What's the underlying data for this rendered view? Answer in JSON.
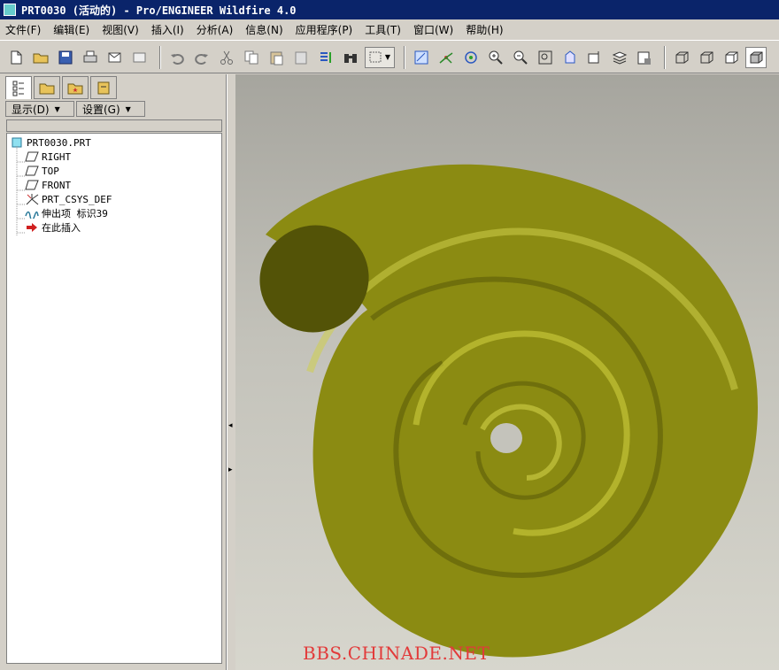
{
  "window": {
    "title": "PRT0030 (活动的) - Pro/ENGINEER Wildfire 4.0"
  },
  "menus": [
    "文件(F)",
    "编辑(E)",
    "视图(V)",
    "插入(I)",
    "分析(A)",
    "信息(N)",
    "应用程序(P)",
    "工具(T)",
    "窗口(W)",
    "帮助(H)"
  ],
  "panel": {
    "display_label": "显示(D)",
    "settings_label": "设置(G)"
  },
  "tree": {
    "root": "PRT0030.PRT",
    "items": [
      {
        "label": "RIGHT",
        "icon": "datum-plane-icon"
      },
      {
        "label": "TOP",
        "icon": "datum-plane-icon"
      },
      {
        "label": "FRONT",
        "icon": "datum-plane-icon"
      },
      {
        "label": "PRT_CSYS_DEF",
        "icon": "coordinate-system-icon"
      },
      {
        "label": "伸出项 标识39",
        "icon": "protrusion-icon"
      },
      {
        "label": "在此插入",
        "icon": "insert-here-arrow-icon"
      }
    ]
  },
  "watermark": "BBS.CHINADE.NET",
  "colors": {
    "spiral": "#9b9b18",
    "spiral_highlight": "#c8c83a",
    "spiral_shadow": "#5a5a08",
    "title_bg": "#0a246a"
  }
}
